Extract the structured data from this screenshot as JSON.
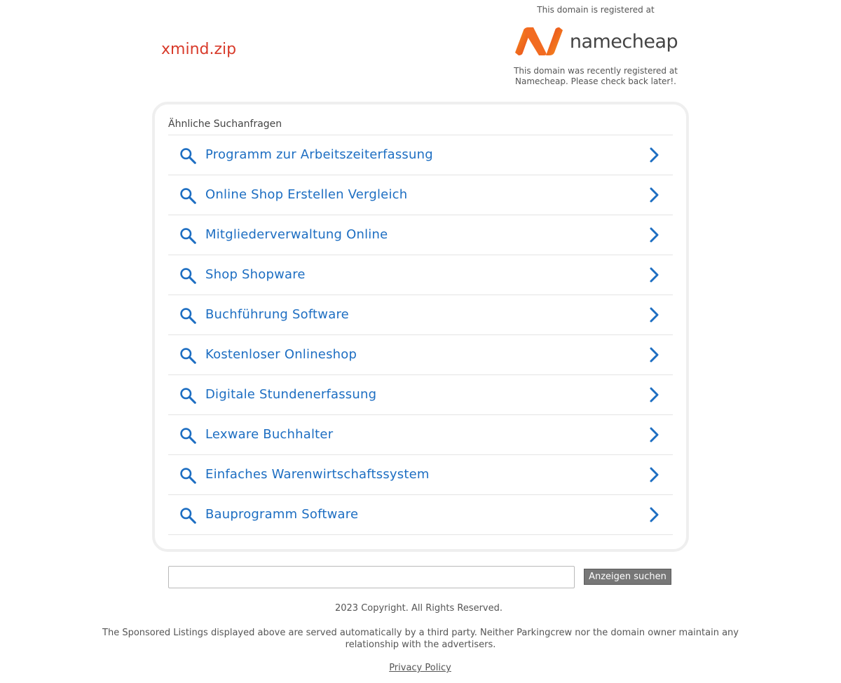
{
  "header": {
    "domain_name": "xmind.zip",
    "registrar_intro": "This domain is registered at",
    "registrar_logo_text": "namecheap",
    "registrar_note": "This domain was recently registered at Namecheap. Please check back later!."
  },
  "related": {
    "title": "Ähnliche Suchanfragen",
    "items": [
      {
        "label": "Programm zur Arbeitszeiterfassung"
      },
      {
        "label": "Online Shop Erstellen Vergleich"
      },
      {
        "label": "Mitgliederverwaltung Online"
      },
      {
        "label": "Shop Shopware"
      },
      {
        "label": "Buchführung Software"
      },
      {
        "label": "Kostenloser Onlineshop"
      },
      {
        "label": "Digitale Stundenerfassung"
      },
      {
        "label": "Lexware Buchhalter"
      },
      {
        "label": "Einfaches Warenwirtschaftssystem"
      },
      {
        "label": "Bauprogramm Software"
      }
    ],
    "item_icon": "search-icon",
    "item_arrow_icon": "chevron-right-icon"
  },
  "search": {
    "value": "",
    "button_label": "Anzeigen suchen"
  },
  "footer": {
    "copyright": "2023 Copyright. All Rights Reserved.",
    "disclaimer": "The Sponsored Listings displayed above are served automatically by a third party. Neither Parkingcrew nor the domain owner maintain any relationship with the advertisers.",
    "privacy_link": "Privacy Policy"
  },
  "colors": {
    "domain_name": "#d83a2a",
    "link_blue": "#1d6ec2",
    "logo_orange": "#f26b21",
    "button_bg": "#777777"
  }
}
